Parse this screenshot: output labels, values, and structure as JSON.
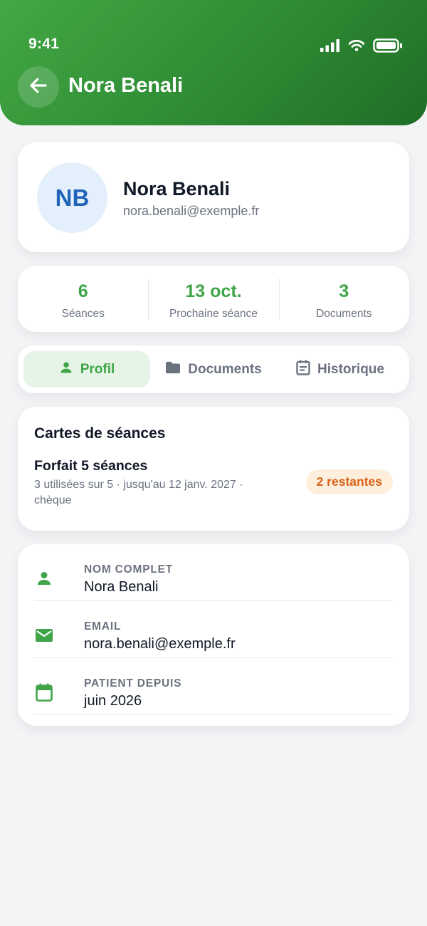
{
  "status_bar": {
    "time": "9:41"
  },
  "header": {
    "title": "Nora Benali"
  },
  "profile": {
    "initials": "NB",
    "name": "Nora Benali",
    "email": "nora.benali@exemple.fr"
  },
  "stats": [
    {
      "value": "6",
      "label": "Séances"
    },
    {
      "value": "13 oct.",
      "label": "Prochaine séance"
    },
    {
      "value": "3",
      "label": "Documents"
    }
  ],
  "tabs": [
    {
      "label": "Profil",
      "icon": "person-icon",
      "active": true
    },
    {
      "label": "Documents",
      "icon": "folder-icon",
      "active": false
    },
    {
      "label": "Historique",
      "icon": "calendar-list-icon",
      "active": false
    }
  ],
  "session_cards": {
    "title": "Cartes de séances",
    "items": [
      {
        "name": "Forfait 5 séances",
        "details": "3 utilisées sur 5 · jusqu'au 12 janv. 2027 · chèque",
        "badge": "2 restantes"
      }
    ]
  },
  "info": [
    {
      "label": "NOM COMPLET",
      "value": "Nora Benali",
      "icon": "person-icon"
    },
    {
      "label": "EMAIL",
      "value": "nora.benali@exemple.fr",
      "icon": "mail-icon"
    },
    {
      "label": "PATIENT DEPUIS",
      "value": "juin 2026",
      "icon": "calendar-icon"
    }
  ],
  "colors": {
    "primary_green": "#3fa548",
    "header_gradient_start": "#43a844",
    "header_gradient_end": "#1f6e25",
    "avatar_bg": "#e3f0fc",
    "avatar_text": "#1f64b7",
    "badge_bg": "#fdefdc",
    "badge_text": "#d9621a",
    "muted_text": "#6b7280",
    "background": "#f3f4f6"
  }
}
